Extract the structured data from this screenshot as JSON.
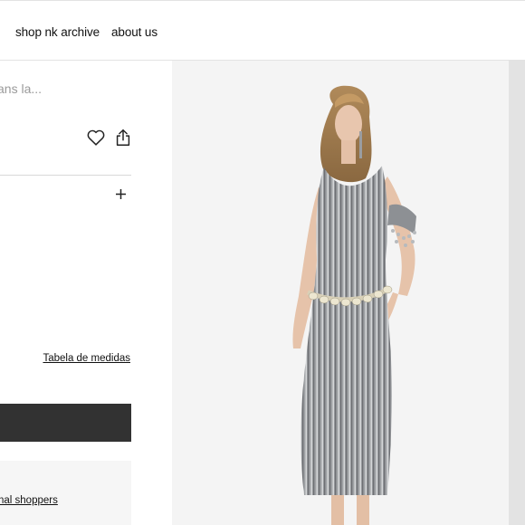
{
  "nav": {
    "shop_label": "shop nk archive",
    "about_label": "about us"
  },
  "product": {
    "description_truncated": "ans la...",
    "size_guide_label": "Tabela de medidas",
    "add_to_bag_label": "",
    "personal_shopper_label": "nal shoppers"
  },
  "icons": {
    "wishlist": "heart-icon",
    "share": "share-icon",
    "expand": "plus-icon"
  },
  "colors": {
    "button_dark": "#323232",
    "gallery_bg": "#f4f4f4",
    "info_box_bg": "#f6f6f6"
  }
}
